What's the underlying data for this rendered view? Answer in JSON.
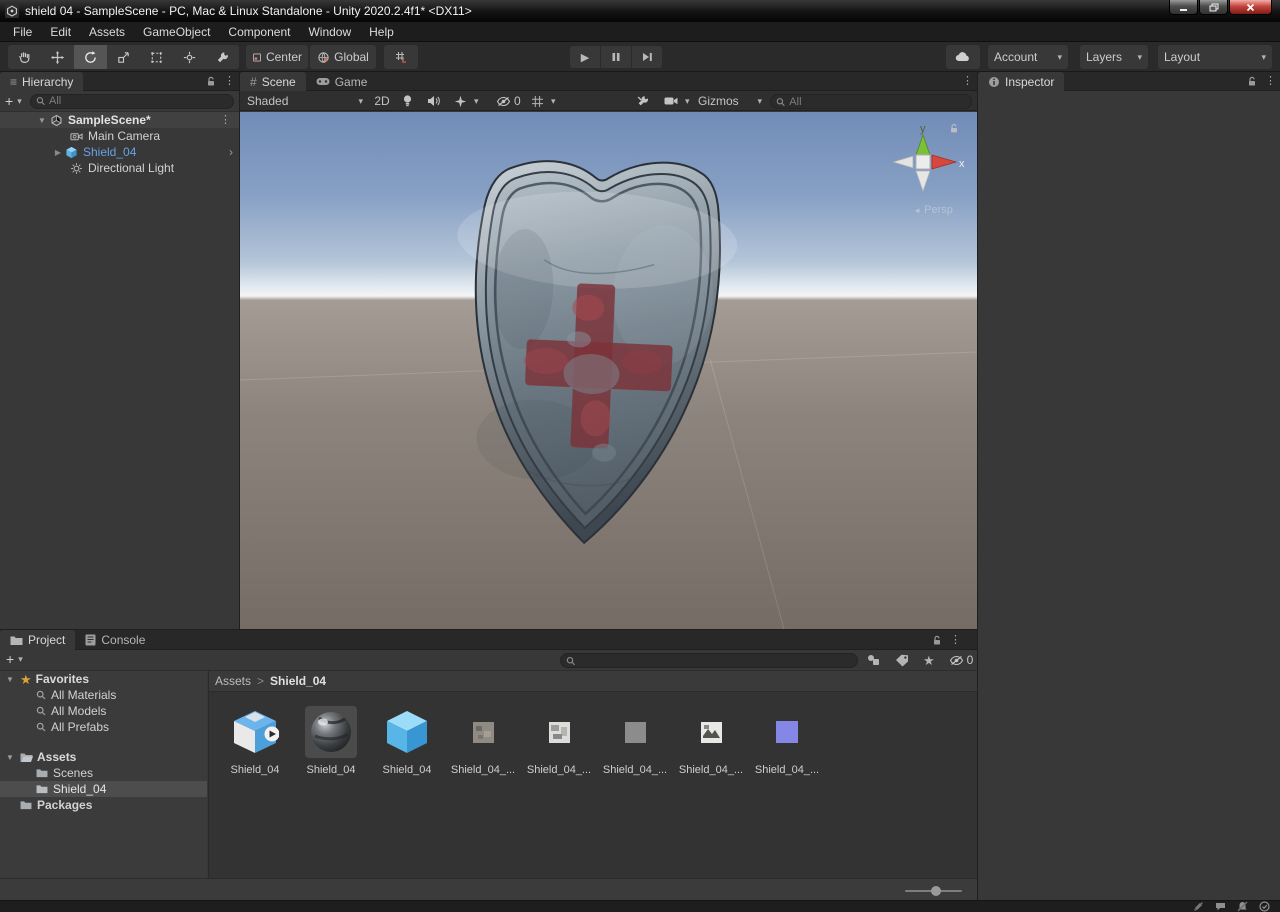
{
  "window": {
    "title": "shield 04 - SampleScene - PC, Mac & Linux Standalone - Unity 2020.2.4f1* <DX11>"
  },
  "menu": {
    "items": [
      "File",
      "Edit",
      "Assets",
      "GameObject",
      "Component",
      "Window",
      "Help"
    ]
  },
  "toolbar": {
    "pivot": "Center",
    "space": "Global",
    "account": "Account",
    "layers": "Layers",
    "layout": "Layout"
  },
  "hierarchy": {
    "title": "Hierarchy",
    "search_placeholder": "All",
    "scene_name": "SampleScene*",
    "items": [
      {
        "name": "Main Camera"
      },
      {
        "name": "Shield_04"
      },
      {
        "name": "Directional Light"
      }
    ]
  },
  "scene": {
    "tab_scene": "Scene",
    "tab_game": "Game",
    "shading": "Shaded",
    "mode_2d": "2D",
    "hidden_count": "0",
    "gizmos": "Gizmos",
    "search_placeholder": "All",
    "axis_x": "x",
    "axis_y": "y",
    "projection": "Persp"
  },
  "inspector": {
    "title": "Inspector"
  },
  "project": {
    "tab_project": "Project",
    "tab_console": "Console",
    "favorites_label": "Favorites",
    "favorites": [
      {
        "name": "All Materials"
      },
      {
        "name": "All Models"
      },
      {
        "name": "All Prefabs"
      }
    ],
    "assets_label": "Assets",
    "folders": [
      {
        "name": "Scenes"
      },
      {
        "name": "Shield_04"
      }
    ],
    "packages_label": "Packages",
    "breadcrumb_root": "Assets",
    "breadcrumb_current": "Shield_04",
    "hidden_count": "0",
    "assets": [
      {
        "label": "Shield_04",
        "type": "prefab"
      },
      {
        "label": "Shield_04",
        "type": "material"
      },
      {
        "label": "Shield_04",
        "type": "model"
      },
      {
        "label": "Shield_04_...",
        "type": "texture"
      },
      {
        "label": "Shield_04_...",
        "type": "texture"
      },
      {
        "label": "Shield_04_...",
        "type": "texture"
      },
      {
        "label": "Shield_04_...",
        "type": "texture"
      },
      {
        "label": "Shield_04_...",
        "type": "normal-map"
      }
    ]
  },
  "icons": {
    "kebab": "⋮",
    "dropdown_arrow": "▾",
    "foldout_open": "▼",
    "foldout_closed": "▶",
    "chevron_right": "›",
    "breadcrumb_separator": ">",
    "hamburger": "≡",
    "star": "★",
    "plus": "+",
    "play": "▶",
    "persp_arrow": "◄",
    "scene_grid": "#"
  },
  "colors": {
    "selected_text_blue": "#6aa1e6",
    "sky_top": "#718cb8",
    "sky_horizon": "#f3f5f5",
    "ground": "#8d857d",
    "selection_gray": "#4b4b4b",
    "close_button_red": "#c4453c"
  }
}
